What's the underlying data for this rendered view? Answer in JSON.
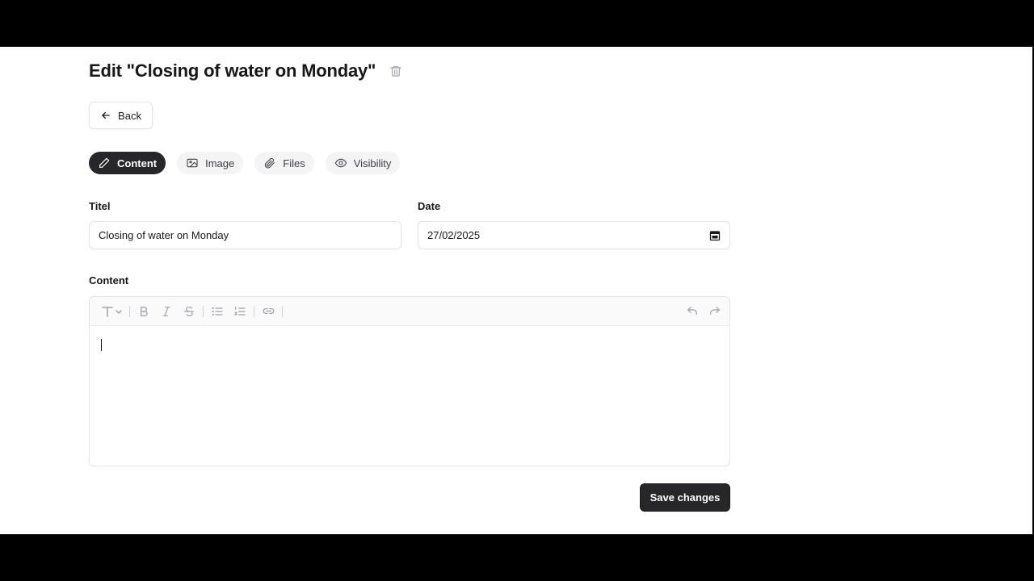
{
  "page": {
    "title": "Edit \"Closing of water on Monday\"",
    "back_label": "Back"
  },
  "tabs": [
    {
      "label": "Content",
      "icon": "pencil-icon",
      "active": true
    },
    {
      "label": "Image",
      "icon": "image-icon",
      "active": false
    },
    {
      "label": "Files",
      "icon": "paperclip-icon",
      "active": false
    },
    {
      "label": "Visibility",
      "icon": "eye-icon",
      "active": false
    }
  ],
  "form": {
    "title_label": "Titel",
    "title_value": "Closing of water on Monday",
    "date_label": "Date",
    "date_value": "27/02/2025",
    "content_label": "Content",
    "content_value": ""
  },
  "toolbar": {
    "buttons": [
      "text-style-icon",
      "bold-icon",
      "italic-icon",
      "strikethrough-icon",
      "bullet-list-icon",
      "numbered-list-icon",
      "link-icon",
      "undo-icon",
      "redo-icon"
    ]
  },
  "actions": {
    "save_label": "Save changes"
  },
  "colors": {
    "primary": "#27272a",
    "border": "#e4e4e7",
    "tab_inactive_bg": "#f4f4f5"
  }
}
